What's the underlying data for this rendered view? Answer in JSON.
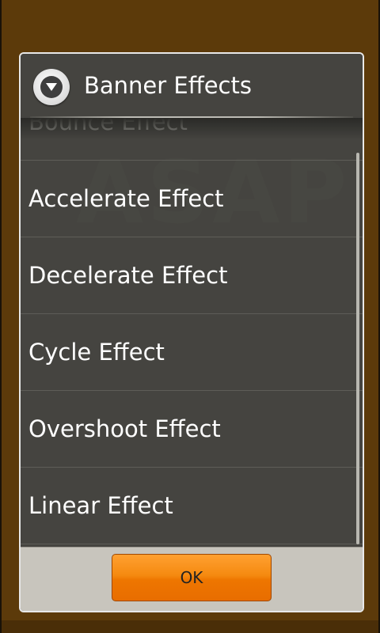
{
  "dialog": {
    "title": "Banner Effects",
    "icon": "dropdown-circle-icon",
    "watermark_text": "ASAP",
    "items": [
      {
        "label": "Bounce Effect"
      },
      {
        "label": "Accelerate Effect"
      },
      {
        "label": "Decelerate Effect"
      },
      {
        "label": "Cycle Effect"
      },
      {
        "label": "Overshoot Effect"
      },
      {
        "label": "Linear Effect"
      }
    ],
    "ok_label": "OK"
  },
  "colors": {
    "background": "#5c3a0a",
    "dialog_body": "#454440",
    "button_bar": "#c8c5bd",
    "button_accent": "#f58a10"
  }
}
